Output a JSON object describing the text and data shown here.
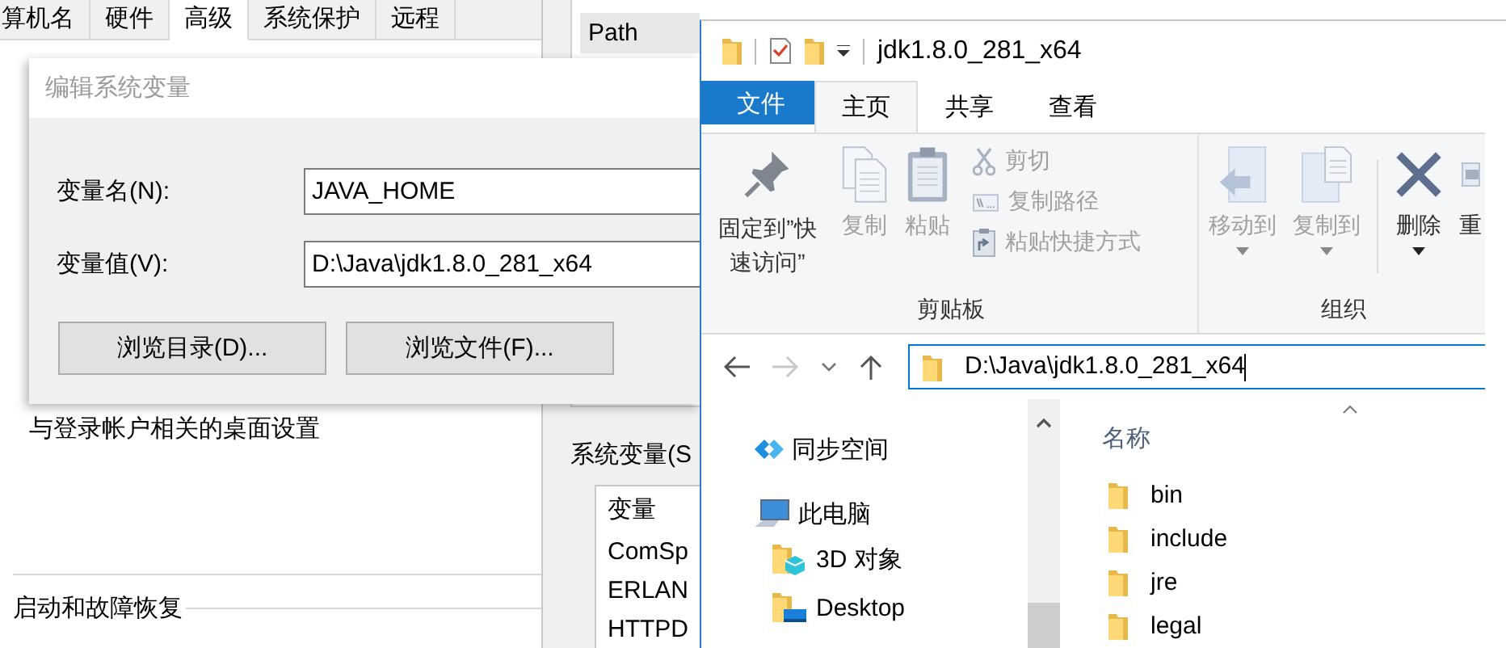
{
  "system_properties": {
    "tabs": [
      {
        "label": "算机名",
        "selected": false
      },
      {
        "label": "硬件",
        "selected": false
      },
      {
        "label": "高级",
        "selected": true
      },
      {
        "label": "系统保护",
        "selected": false
      },
      {
        "label": "远程",
        "selected": false
      }
    ],
    "desktop_settings_text": "与登录帐户相关的桌面设置",
    "startup_heading": "启动和故障恢复"
  },
  "environment_variables": {
    "selected_row": "Path",
    "system_variables_label": "系统变量(S",
    "list_header": "变量",
    "rows": [
      "ComSp",
      "ERLAN",
      "HTTPD"
    ]
  },
  "edit_dialog": {
    "title": "编辑系统变量",
    "fields": [
      {
        "label": "变量名(N):",
        "value": "JAVA_HOME"
      },
      {
        "label": "变量值(V):",
        "value": "D:\\Java\\jdk1.8.0_281_x64"
      }
    ],
    "buttons": [
      "浏览目录(D)...",
      "浏览文件(F)..."
    ]
  },
  "explorer": {
    "title": "jdk1.8.0_281_x64",
    "ribbon_tabs": [
      {
        "label": "文件",
        "kind": "file",
        "selected": false
      },
      {
        "label": "主页",
        "kind": "tab",
        "selected": true
      },
      {
        "label": "共享",
        "kind": "tab",
        "selected": false
      },
      {
        "label": "查看",
        "kind": "tab",
        "selected": false
      }
    ],
    "ribbon_groups": [
      {
        "label": "剪贴板",
        "commands": [
          {
            "label": "固定到”快速访问”",
            "kind": "pin",
            "disabled": false
          },
          {
            "label": "复制",
            "kind": "copy",
            "disabled": true
          },
          {
            "label": "粘贴",
            "kind": "paste",
            "disabled": true
          },
          {
            "label": "剪切",
            "kind": "cut",
            "disabled": true
          },
          {
            "label": "复制路径",
            "kind": "copy-path",
            "disabled": true
          },
          {
            "label": "粘贴快捷方式",
            "kind": "paste-shortcut",
            "disabled": true
          }
        ]
      },
      {
        "label": "组织",
        "commands": [
          {
            "label": "移动到",
            "kind": "move",
            "disabled": true,
            "has_menu": true
          },
          {
            "label": "复制到",
            "kind": "copy-to",
            "disabled": true,
            "has_menu": true
          },
          {
            "label": "删除",
            "kind": "delete",
            "disabled": false,
            "has_menu": true
          },
          {
            "label": "重",
            "kind": "rename",
            "disabled": false
          }
        ]
      }
    ],
    "address": "D:\\Java\\jdk1.8.0_281_x64",
    "nav_items": [
      {
        "label": "同步空间",
        "kind": "sync"
      },
      {
        "label": "此电脑",
        "kind": "pc",
        "children": [
          {
            "label": "3D 对象",
            "kind": "objects"
          },
          {
            "label": "Desktop",
            "kind": "desktop"
          }
        ]
      }
    ],
    "name_column": "名称",
    "files": [
      "bin",
      "include",
      "jre",
      "legal"
    ]
  }
}
